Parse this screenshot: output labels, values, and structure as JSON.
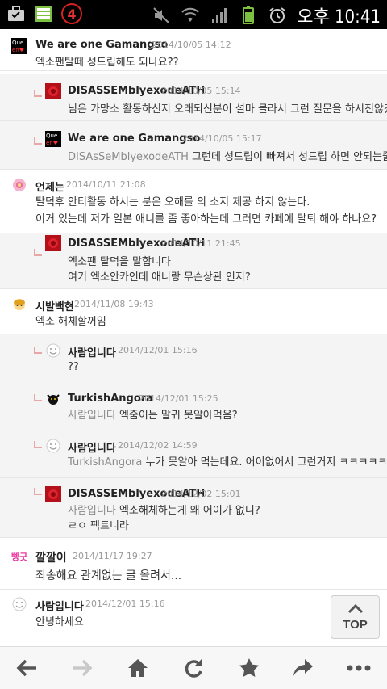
{
  "status_bar": {
    "notification_count": "4",
    "time": "오후 10:41",
    "icons": [
      "briefcase-icon",
      "storage-icon",
      "mute-icon",
      "wifi-icon",
      "signal-icon",
      "battery-icon",
      "alarm-icon"
    ]
  },
  "comments": [
    {
      "author": "We are one Gamangso",
      "date": "2014/10/05 14:12",
      "lines": [
        "엑소팬탈떼 성드립해도 되나요??"
      ],
      "avatar": "queen-avatar"
    },
    {
      "author": "DISASSEMblyexodeATH",
      "date": "2014/10/05 15:14",
      "lines": [
        "님은 가망소 활동하신지 오래되신분이 설마 몰라서 그런 질문을 하시진않겠죠"
      ],
      "avatar": "rose-avatar",
      "reply": true
    },
    {
      "author": "We are one Gamangso",
      "date": "2014/10/05 15:17",
      "mention": "DISAsSeMblyexodeATH",
      "lines": [
        "그런데 성드립이 빠져서 성드립 하면 안되는줄 알았어요"
      ],
      "avatar": "queen-avatar",
      "reply": true
    },
    {
      "author": "언제는",
      "date": "2014/10/11 21:08",
      "lines": [
        "탈덕후 안티활동 하시는 분은 오해를 의 소지 제공 하지 않는다.",
        "이거 있는데 저가 일본 애니를 좀 좋아하는데 그러면 카페에 탈퇴 해야 하나요?"
      ],
      "avatar": "flower-avatar"
    },
    {
      "author": "DISASSEMblyexodeATH",
      "date": "2014/10/11 21:45",
      "lines": [
        "엑소팬 탈덕을 말합니다",
        "여기 엑소안카인데 애니랑 무슨상관 인지?"
      ],
      "avatar": "rose-avatar",
      "reply": true
    },
    {
      "author": "시발백현",
      "date": "2014/11/08 19:43",
      "lines": [
        "엑소 해체할꺼임"
      ],
      "avatar": "girl-avatar"
    },
    {
      "author": "사람입니다",
      "date": "2014/12/01 15:16",
      "lines": [
        "??"
      ],
      "avatar": "smile-avatar",
      "reply": true
    },
    {
      "author": "TurkishAngora",
      "date": "2014/12/01 15:25",
      "mention": "사람입니다",
      "lines": [
        "엑줌이는 말귀 못알아먹음?"
      ],
      "avatar": "cat-avatar",
      "reply": true
    },
    {
      "author": "사람입니다",
      "date": "2014/12/02 14:59",
      "mention": "TurkishAngora",
      "lines": [
        "누가 못알아 먹는데요. 어이없어서 그런거지 ㅋㅋㅋㅋㅋ"
      ],
      "avatar": "smile-avatar",
      "reply": true
    },
    {
      "author": "DISASSEMblyexodeATH",
      "date": "2014/12/02 15:01",
      "mention": "사람입니다",
      "lines": [
        "엑소해체하는게 왜 어이가 없니?",
        "ㄹㅇ 팩트니라"
      ],
      "avatar": "rose-avatar",
      "reply": true
    },
    {
      "author": "깔깔이",
      "date": "2014/11/17 19:27",
      "lines": [
        "죄송해요 관계없는 글 올려서..."
      ],
      "avatar": "ppang-avatar"
    },
    {
      "author": "사람입니다",
      "date": "2014/12/01 15:16",
      "lines": [
        "안녕하세요"
      ],
      "avatar": "smile-avatar"
    }
  ],
  "top_button": {
    "label": "TOP"
  },
  "toolbar": {
    "buttons": [
      "back-icon",
      "forward-icon",
      "home-icon",
      "refresh-icon",
      "bookmark-star-icon",
      "share-icon",
      "more-icon"
    ]
  },
  "colors": {
    "accent_red": "#c8121e",
    "reply_bg": "#f4f4f4",
    "reply_mark": "#e8a7a7"
  }
}
